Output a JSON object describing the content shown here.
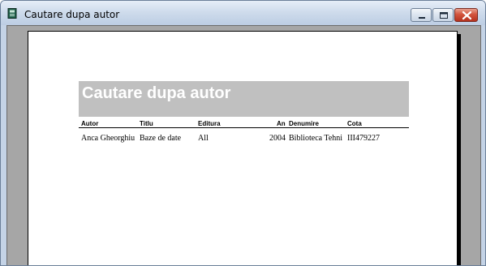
{
  "window": {
    "title": "Cautare dupa autor",
    "icon": "report-icon"
  },
  "report": {
    "title": "Cautare dupa autor",
    "columns": [
      "Autor",
      "Titlu",
      "Editura",
      "An",
      "Denumire",
      "Cota"
    ],
    "rows": [
      [
        "Anca Gheorghiu",
        "Baze de date",
        "All",
        "2004",
        "Biblioteca Tehni",
        "III479227"
      ]
    ]
  },
  "colors": {
    "header_band": "#c0c0c0",
    "client_background": "#a6a6a6",
    "page": "#ffffff"
  }
}
